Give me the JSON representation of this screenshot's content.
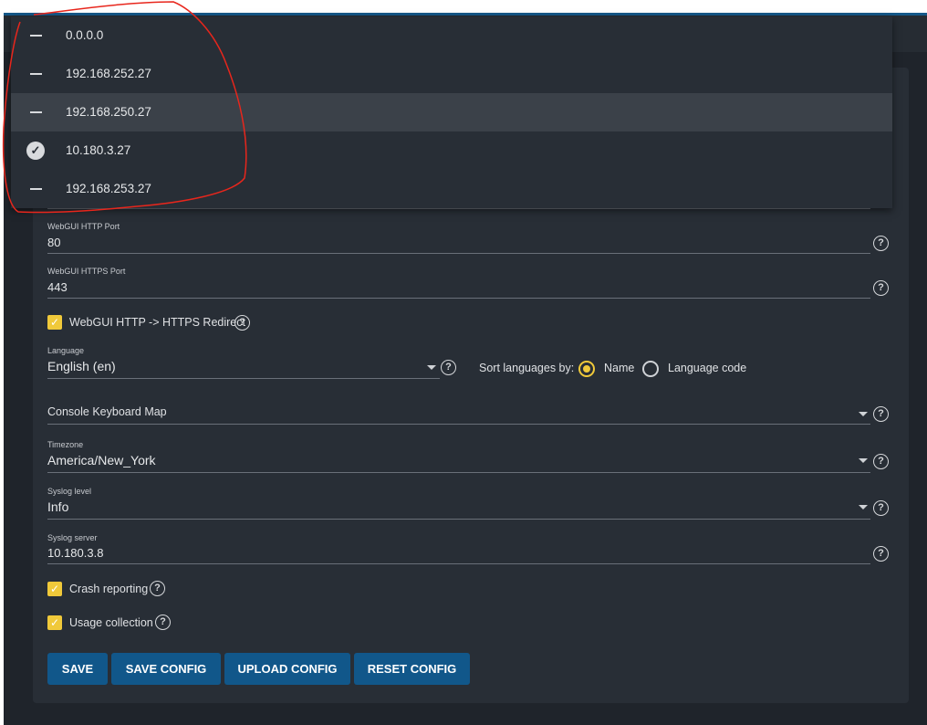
{
  "dropdown": {
    "options": [
      {
        "label": "0.0.0.0",
        "selected": false
      },
      {
        "label": "192.168.252.27",
        "selected": false
      },
      {
        "label": "192.168.250.27",
        "selected": false,
        "highlighted": true
      },
      {
        "label": "10.180.3.27",
        "selected": true
      },
      {
        "label": "192.168.253.27",
        "selected": false
      }
    ]
  },
  "form": {
    "http_port": {
      "label": "WebGUI HTTP Port",
      "value": "80"
    },
    "https_port": {
      "label": "WebGUI HTTPS Port",
      "value": "443"
    },
    "redirect": {
      "label": "WebGUI HTTP -> HTTPS Redirect",
      "checked": true
    },
    "language": {
      "label": "Language",
      "value": "English (en)"
    },
    "sort": {
      "label": "Sort languages by:",
      "options": [
        "Name",
        "Language code"
      ],
      "selected": "Name"
    },
    "keyboard": {
      "placeholder": "Console Keyboard Map"
    },
    "timezone": {
      "label": "Timezone",
      "value": "America/New_York"
    },
    "syslog_level": {
      "label": "Syslog level",
      "value": "Info"
    },
    "syslog_server": {
      "label": "Syslog server",
      "value": "10.180.3.8"
    },
    "crash": {
      "label": "Crash reporting",
      "checked": true
    },
    "usage": {
      "label": "Usage collection",
      "checked": true
    }
  },
  "buttons": {
    "save": "SAVE",
    "save_config": "SAVE CONFIG",
    "upload_config": "UPLOAD CONFIG",
    "reset_config": "RESET CONFIG"
  },
  "icons": {
    "help": "?",
    "check": "✓"
  },
  "colors": {
    "accent": "#f0c93a",
    "button": "#11578a",
    "annotation": "#e8261c"
  }
}
